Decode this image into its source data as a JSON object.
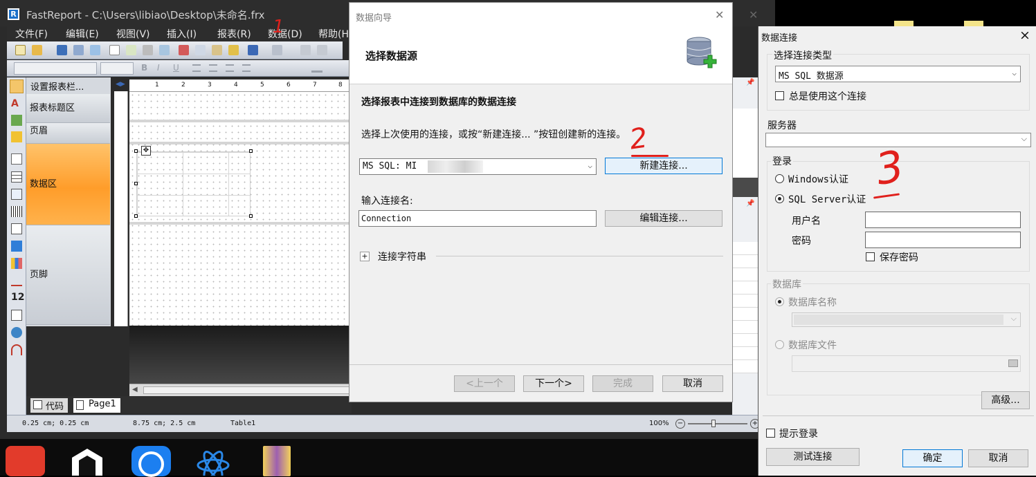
{
  "main_window": {
    "title": "FastReport - C:\\Users\\libiao\\Desktop\\未命名.frx",
    "logo_letter": "R",
    "menu": [
      "文件(F)",
      "编辑(E)",
      "视图(V)",
      "插入(I)",
      "报表(R)",
      "数据(D)",
      "帮助(H)"
    ],
    "bands_panel_title": "设置报表栏...",
    "bands": [
      "报表标题区",
      "页眉",
      "数据区",
      "页脚"
    ],
    "ruler_numbers": [
      "1",
      "2",
      "3",
      "4",
      "5",
      "6",
      "7",
      "8"
    ],
    "tabs": [
      "代码",
      "Page1"
    ],
    "status": {
      "pos1": "0.25 cm; 0.25 cm",
      "pos2": "8.75 cm; 2.5 cm",
      "object": "Table1",
      "zoom": "100%"
    },
    "left_tool_text": "12"
  },
  "wizard": {
    "title": "数据向导",
    "header_title": "选择数据源",
    "section_title": "选择报表中连接到数据库的数据连接",
    "instruction": "选择上次使用的连接，或按“新建连接... ”按钮创建新的连接。",
    "connection_value": "MS SQL: MI",
    "new_connection_button": "新建连接...",
    "connection_name_label": "输入连接名:",
    "connection_name_value": "Connection",
    "edit_connection_button": "编辑连接...",
    "connection_string_label": "连接字符串",
    "expander_symbol": "+",
    "buttons": {
      "prev": "<上一个",
      "next": "下一个>",
      "finish": "完成",
      "cancel": "取消"
    }
  },
  "conn_dialog": {
    "title": "数据连接",
    "close_symbol": "×",
    "type_group": "选择连接类型",
    "type_value": "MS SQL 数据源",
    "always_use_label": "总是使用这个连接",
    "server_label": "服务器",
    "server_value": "",
    "login_group": "登录",
    "windows_auth_label": "Windows认证",
    "sql_auth_label": "SQL Server认证",
    "username_label": "用户名",
    "password_label": "密码",
    "save_password_label": "保存密码",
    "db_group": "数据库",
    "db_name_label": "数据库名称",
    "db_file_label": "数据库文件",
    "advanced_button": "高级...",
    "prompt_login_label": "提示登录",
    "test_button": "测试连接",
    "ok_button": "确定",
    "cancel_button": "取消"
  },
  "annotations": [
    "1",
    "2",
    "3"
  ],
  "colors": {
    "accent_orange": "#ff9d2a",
    "annotation_red": "#e0201c",
    "taskbar": "#0c0c0c"
  }
}
